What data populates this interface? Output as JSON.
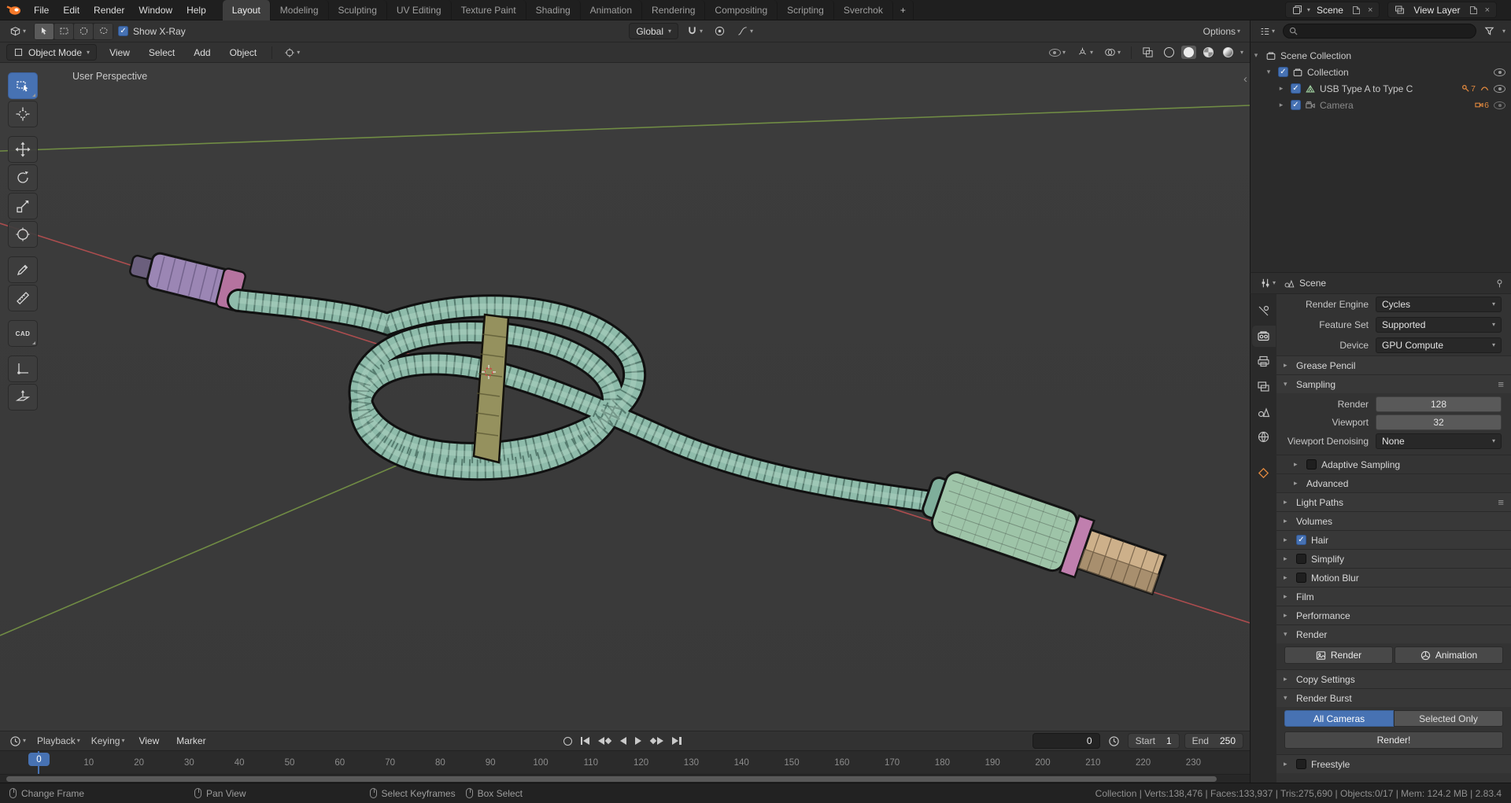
{
  "topbar": {
    "menus": [
      "File",
      "Edit",
      "Render",
      "Window",
      "Help"
    ],
    "workspaces": [
      "Layout",
      "Modeling",
      "Sculpting",
      "UV Editing",
      "Texture Paint",
      "Shading",
      "Animation",
      "Rendering",
      "Compositing",
      "Scripting",
      "Sverchok"
    ],
    "new_workspace": "+",
    "scene_label": "Scene",
    "view_layer_label": "View Layer"
  },
  "viewport_header": {
    "mode": "Object Mode",
    "menus": [
      "View",
      "Select",
      "Add",
      "Object"
    ],
    "xray_label": "Show X-Ray",
    "orientation": "Global",
    "options_label": "Options"
  },
  "viewport": {
    "perspective_label": "User Perspective"
  },
  "tools": {
    "cad_label": "CAD"
  },
  "outliner": {
    "rows": [
      {
        "label": "Scene Collection"
      },
      {
        "label": "Collection"
      },
      {
        "label": "USB Type A to Type C",
        "badge": "7"
      },
      {
        "label": "Camera",
        "badge": "6"
      }
    ]
  },
  "properties": {
    "breadcrumb": "Scene",
    "render_engine_label": "Render Engine",
    "render_engine": "Cycles",
    "feature_set_label": "Feature Set",
    "feature_set": "Supported",
    "device_label": "Device",
    "device": "GPU Compute",
    "grease_pencil": "Grease Pencil",
    "sampling": "Sampling",
    "render_label": "Render",
    "render_samples": "128",
    "viewport_label": "Viewport",
    "viewport_samples": "32",
    "denoising_label": "Viewport Denoising",
    "denoising": "None",
    "adaptive_sampling": "Adaptive Sampling",
    "advanced": "Advanced",
    "light_paths": "Light Paths",
    "volumes": "Volumes",
    "hair": "Hair",
    "simplify": "Simplify",
    "motion_blur": "Motion Blur",
    "film": "Film",
    "performance": "Performance",
    "render_section": "Render",
    "render_button": "Render",
    "animation_button": "Animation",
    "copy_settings": "Copy Settings",
    "render_burst": "Render Burst",
    "all_cameras": "All Cameras",
    "selected_only": "Selected Only",
    "render_bang": "Render!",
    "freestyle": "Freestyle"
  },
  "timeline": {
    "menus": [
      "Playback",
      "Keying",
      "View",
      "Marker"
    ],
    "current_frame": "0",
    "playhead": "0",
    "start_label": "Start",
    "start_value": "1",
    "end_label": "End",
    "end_value": "250",
    "ruler_ticks": [
      "0",
      "10",
      "20",
      "30",
      "40",
      "50",
      "60",
      "70",
      "80",
      "90",
      "100",
      "110",
      "120",
      "130",
      "140",
      "150",
      "160",
      "170",
      "180",
      "190",
      "200",
      "210",
      "220",
      "230"
    ]
  },
  "statusbar": {
    "hints": [
      "Change Frame",
      "Pan View",
      "Select Keyframes",
      "Box Select"
    ],
    "stats": "Collection | Verts:138,476 | Faces:133,937 | Tris:275,690 | Objects:0/17 | Mem: 124.2 MB | 2.83.4"
  },
  "colors": {
    "accent": "#4772b3",
    "cable": "#8fbcab",
    "connector_green": "#9ec4a8",
    "connector_pink": "#c07fae",
    "connector_purple": "#9b86b4",
    "connector_tip_tan": "#cdb08a",
    "axis_x_red": "#b84f51",
    "axis_y_green": "#7a9a46"
  }
}
